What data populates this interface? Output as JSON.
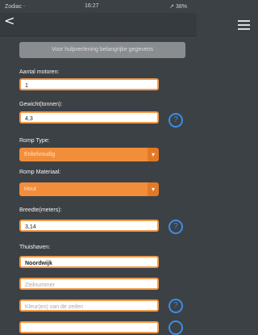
{
  "status_bar": {
    "left": "Zodiac ᐧ",
    "time": "16:27",
    "right": "↗ 38%"
  },
  "nav": {
    "back_icon": "chevron-left-icon",
    "menu_icon": "hamburger-menu-icon"
  },
  "header_button": "Voor hulpverlening belangrijke gegevens",
  "fields": {
    "aantal_motoren": {
      "label": "Aantal motoren:",
      "value": "1"
    },
    "gewicht": {
      "label": "Gewicht(tonnen):",
      "value": "4,3"
    },
    "romp_type": {
      "label": "Romp Type:",
      "value": "Enkelvoudig"
    },
    "romp_materiaal": {
      "label": "Romp Materiaal:",
      "value": "Hout"
    },
    "breedte": {
      "label": "Breedte(meters):",
      "value": "3,14"
    },
    "thuishaven": {
      "label": "Thuishaven:",
      "value": "Noordwijk"
    },
    "zeilnummer": {
      "placeholder": "Zeilnummer"
    },
    "kleur_zeilen": {
      "placeholder": "Kleur(en) van de zeilen"
    }
  },
  "help_symbol": "?",
  "colors": {
    "background": "#3c4146",
    "accent_orange": "#f28e3a",
    "help_blue": "#3d8de4"
  }
}
